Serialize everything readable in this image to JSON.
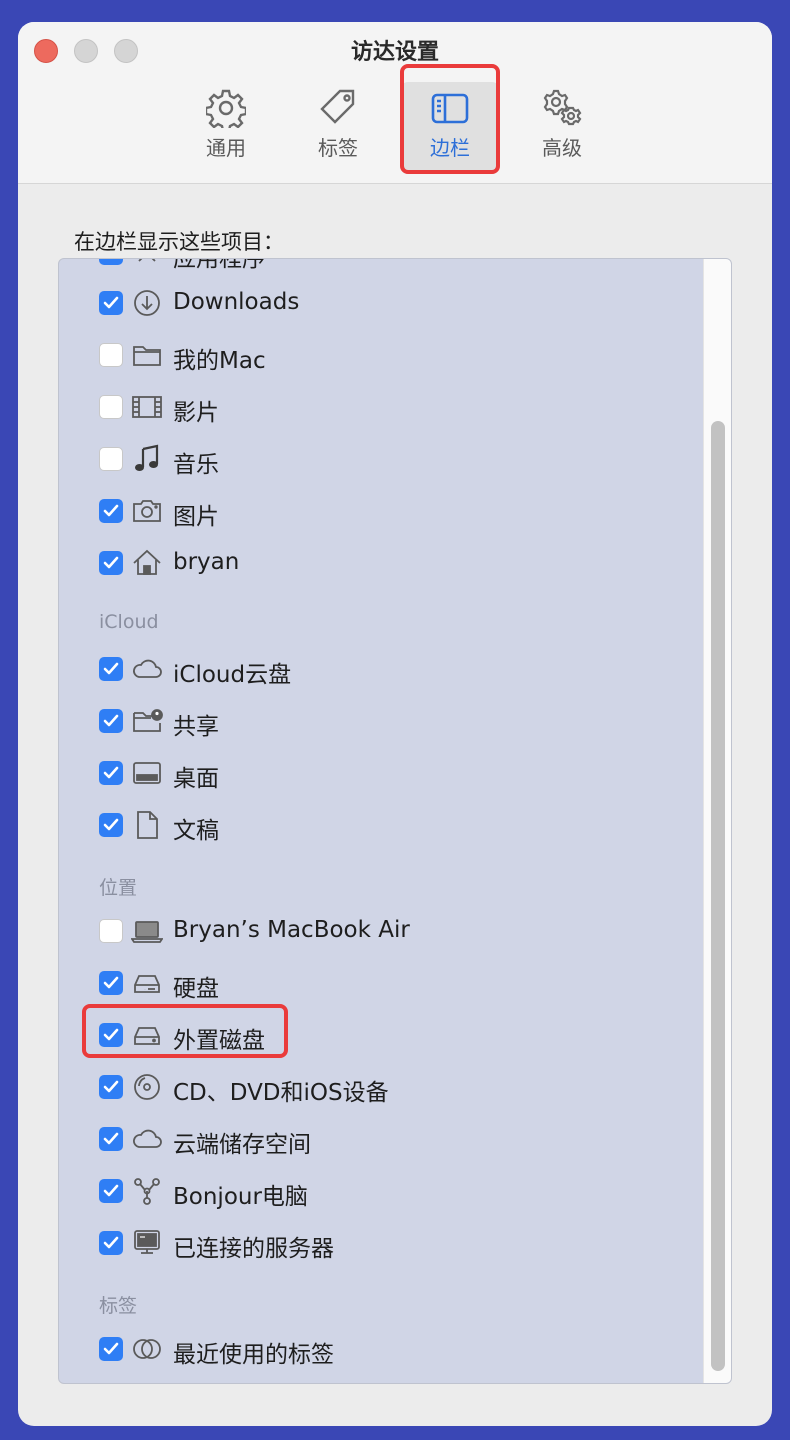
{
  "window": {
    "title": "访达设置"
  },
  "toolbar": {
    "tabs": [
      {
        "label": "通用",
        "icon": "gear-icon"
      },
      {
        "label": "标签",
        "icon": "tag-icon"
      },
      {
        "label": "边栏",
        "icon": "sidebar-icon",
        "selected": true
      },
      {
        "label": "高级",
        "icon": "gears-advanced-icon"
      }
    ]
  },
  "sidebar_settings": {
    "heading": "在边栏显示这些项目：",
    "partial_item": {
      "label": "应用程序",
      "checked": true
    },
    "favorites": [
      {
        "label": "Downloads",
        "checked": true,
        "icon": "download-icon"
      },
      {
        "label": "我的Mac",
        "checked": false,
        "icon": "folder-icon"
      },
      {
        "label": "影片",
        "checked": false,
        "icon": "film-icon"
      },
      {
        "label": "音乐",
        "checked": false,
        "icon": "music-note-icon"
      },
      {
        "label": "图片",
        "checked": true,
        "icon": "camera-icon"
      },
      {
        "label": "bryan",
        "checked": true,
        "icon": "home-icon"
      }
    ],
    "icloud_header": "iCloud",
    "icloud": [
      {
        "label": "iCloud云盘",
        "checked": true,
        "icon": "cloud-icon"
      },
      {
        "label": "共享",
        "checked": true,
        "icon": "shared-folder-icon"
      },
      {
        "label": "桌面",
        "checked": true,
        "icon": "desktop-icon"
      },
      {
        "label": "文稿",
        "checked": true,
        "icon": "document-icon"
      }
    ],
    "locations_header": "位置",
    "locations": [
      {
        "label": "Bryan’s MacBook Air",
        "checked": false,
        "icon": "laptop-icon"
      },
      {
        "label": "硬盘",
        "checked": true,
        "icon": "hard-disk-icon"
      },
      {
        "label": "外置磁盘",
        "checked": true,
        "icon": "external-disk-icon"
      },
      {
        "label": "CD、DVD和iOS设备",
        "checked": true,
        "icon": "disc-icon"
      },
      {
        "label": "云端储存空间",
        "checked": true,
        "icon": "cloud-icon"
      },
      {
        "label": "Bonjour电脑",
        "checked": true,
        "icon": "bonjour-icon"
      },
      {
        "label": "已连接的服务器",
        "checked": true,
        "icon": "server-icon"
      }
    ],
    "tags_header": "标签",
    "tags": [
      {
        "label": "最近使用的标签",
        "checked": true,
        "icon": "tags-circles-icon"
      }
    ]
  },
  "colors": {
    "highlight": "#ea3b3b",
    "accent": "#2f7ef5",
    "list_background": "#d0d5e6"
  }
}
